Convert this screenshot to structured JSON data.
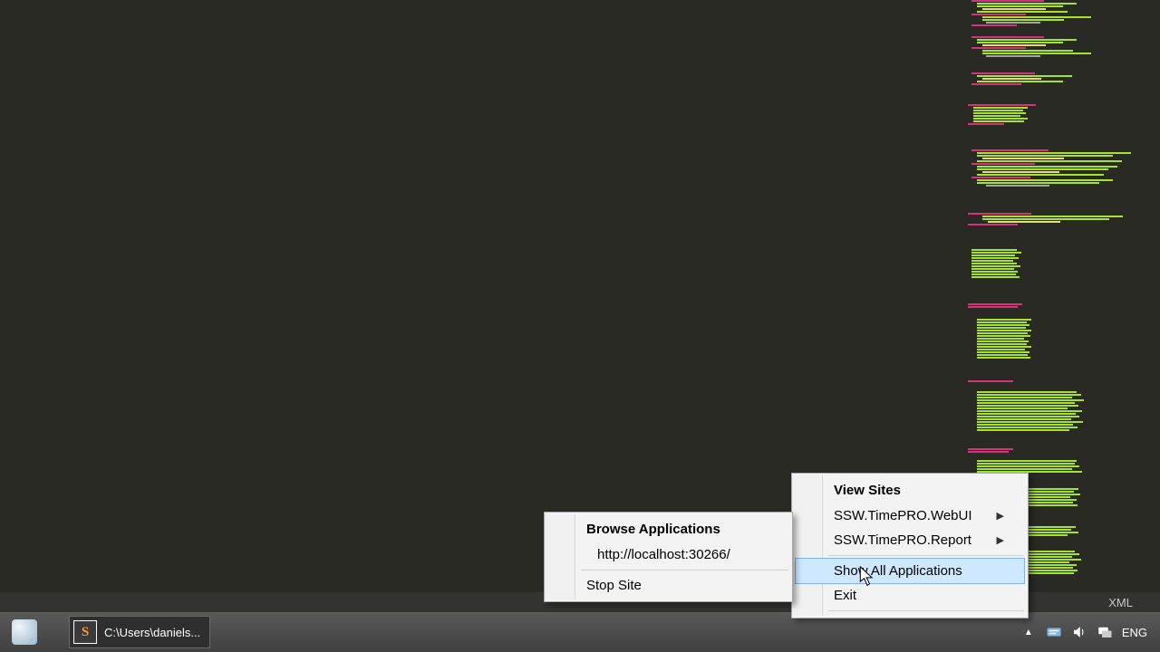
{
  "editor": {
    "status_right": "XML"
  },
  "taskbar": {
    "app_label": "C:\\Users\\daniels...",
    "lang": "ENG"
  },
  "menu_main": {
    "header": "View Sites",
    "items": [
      {
        "label": "SSW.TimePRO.WebUI",
        "submenu": true
      },
      {
        "label": "SSW.TimePRO.Report",
        "submenu": true
      }
    ],
    "show_all": "Show All Applications",
    "exit": "Exit"
  },
  "menu_sub": {
    "header": "Browse Applications",
    "url": "http://localhost:30266/",
    "stop": "Stop Site"
  }
}
